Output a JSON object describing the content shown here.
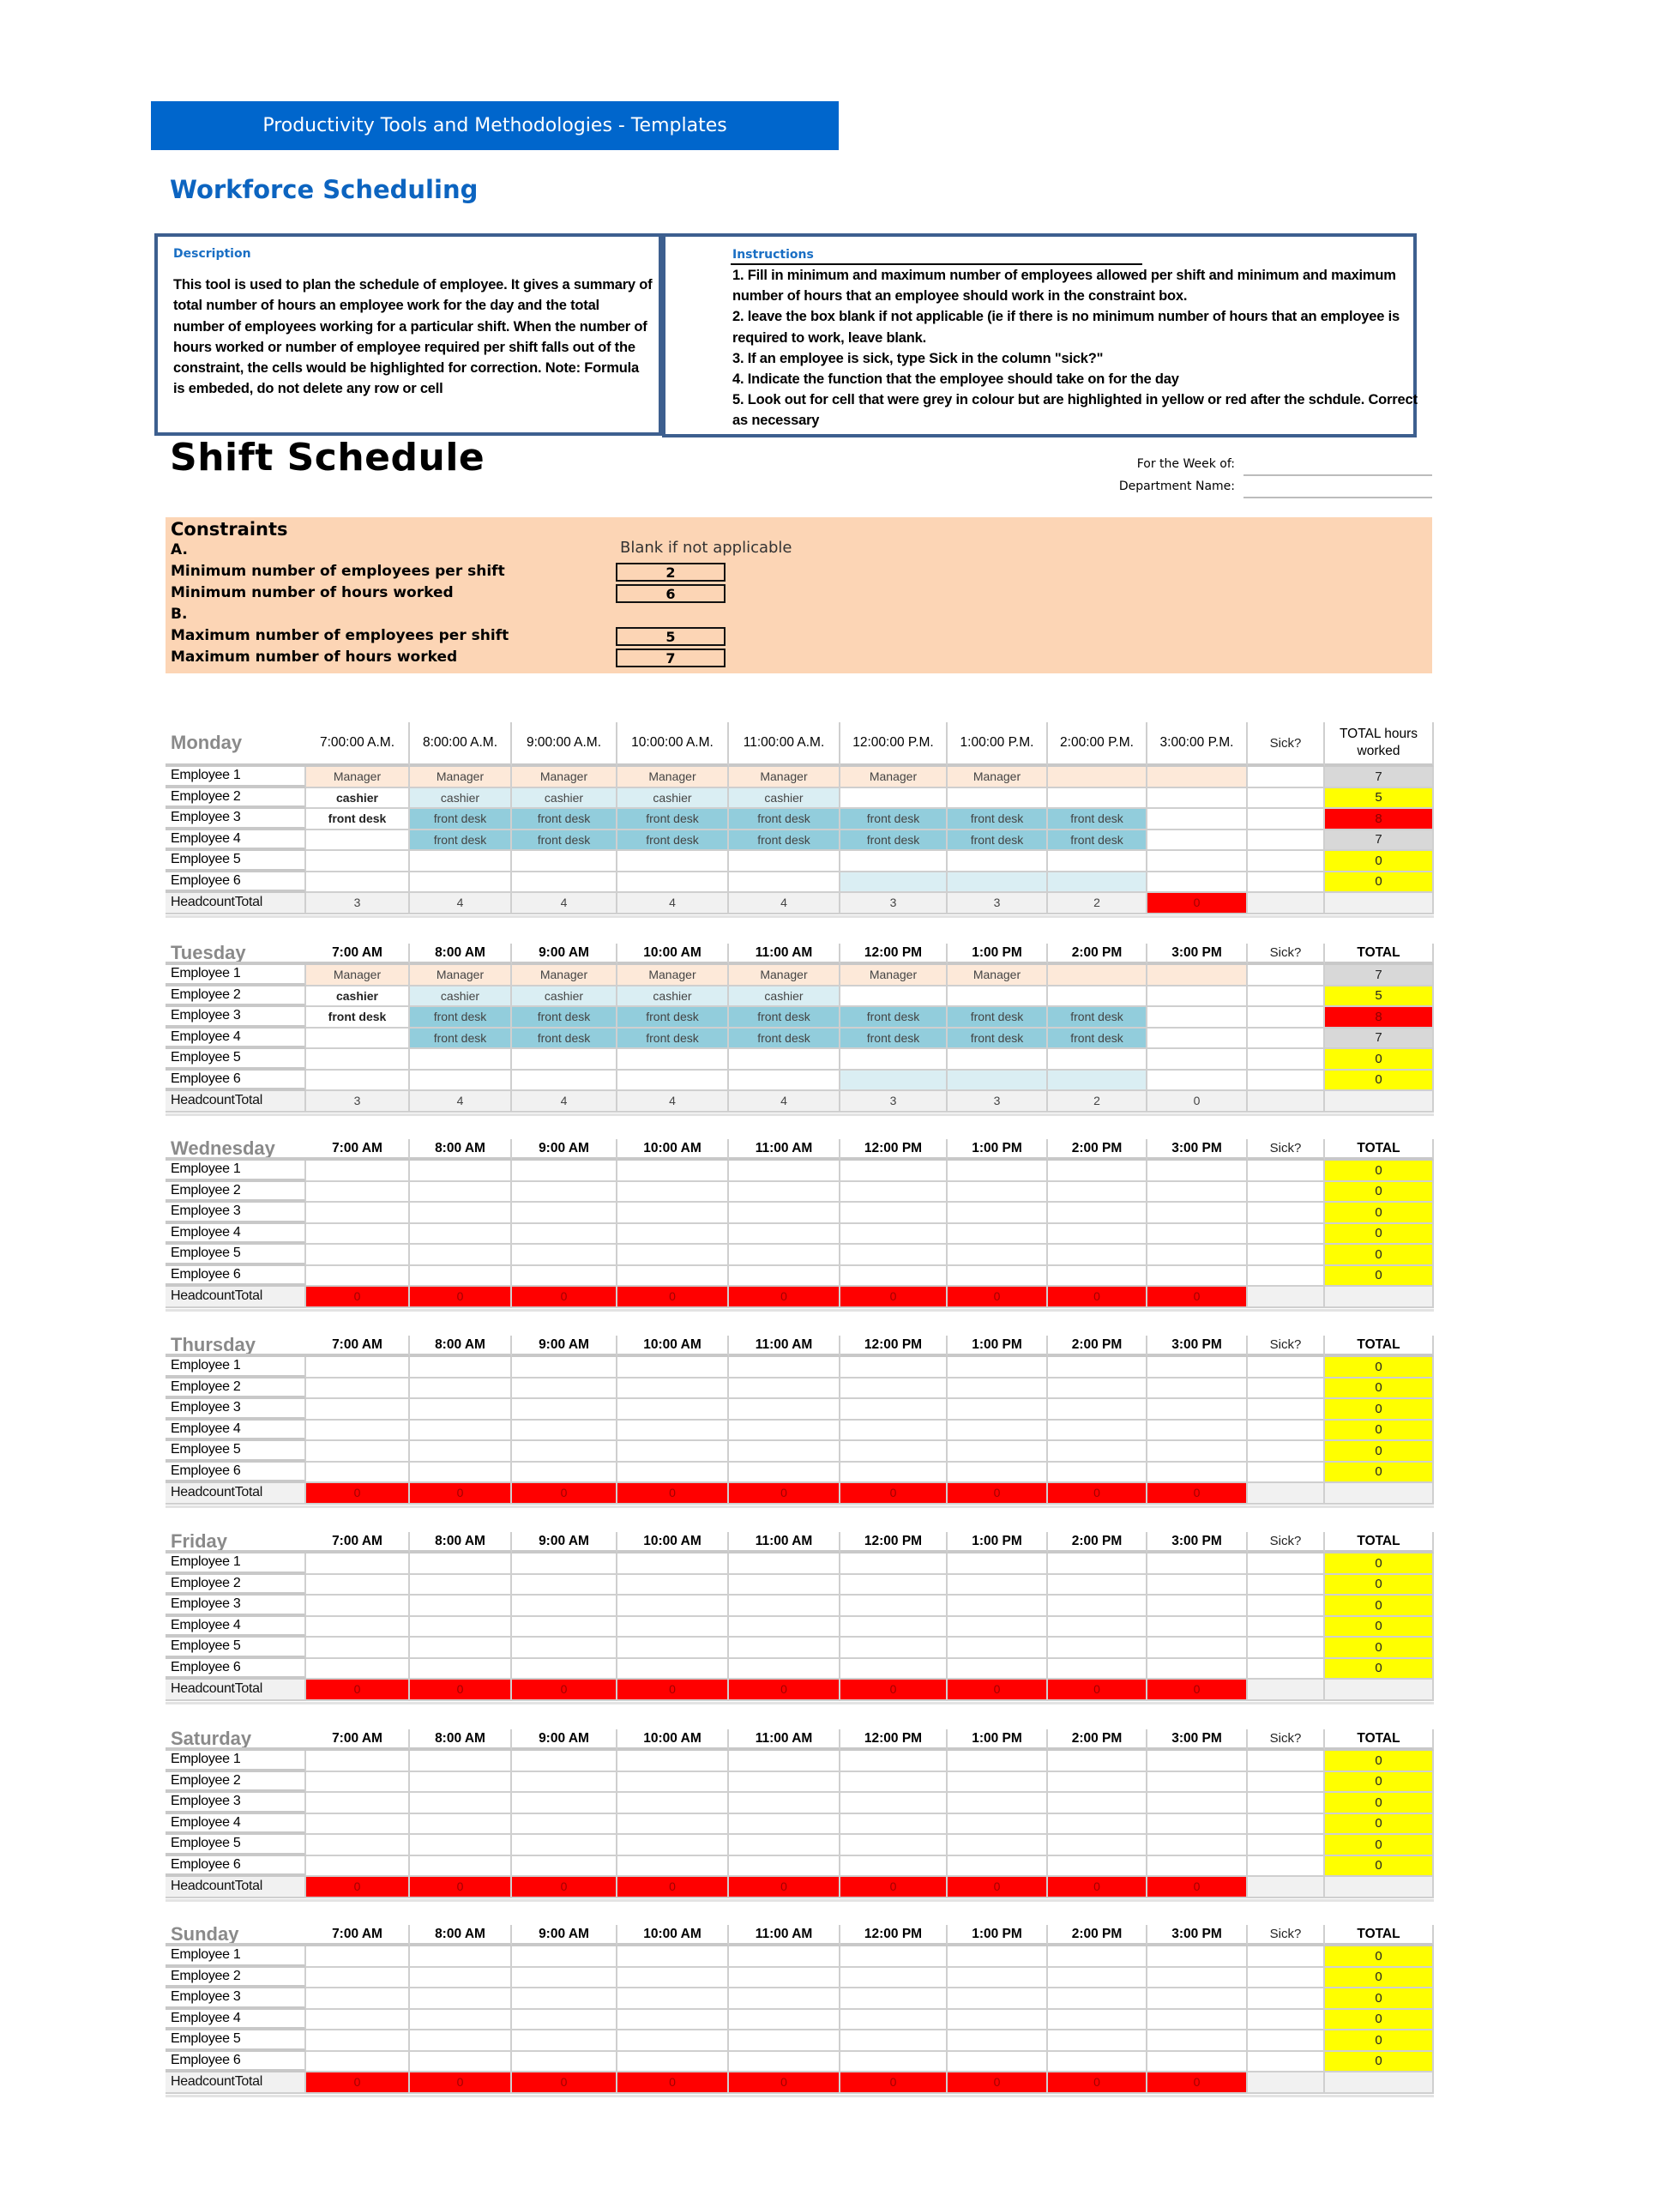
{
  "banner": {
    "title": "Productivity Tools and Methodologies - Templates"
  },
  "page_title": "Workforce Scheduling",
  "description": {
    "heading": "Description",
    "text": "This tool is used to plan the schedule of employee. It gives a summary of total number of hours an employee work for the day and the total number of employees working for a particular shift. When the number of hours worked or number of employee required per shift falls out of the constraint, the cells would be highlighted for correction. Note: Formula is embeded, do not delete any row or cell"
  },
  "instructions": {
    "heading": "Instructions",
    "items": [
      "1. Fill in minimum and maximum number of employees allowed per shift and minimum  and maximum number of hours that an employee should work in the constraint box.",
      "2. leave the box blank if not applicable (ie if there is no minimum number of hours that an employee is required to work, leave blank.",
      "3. If an employee is sick, type Sick in the column \"sick?\"",
      "4. Indicate the function that the employee should take on for the day",
      "5. Look out for cell that were grey in colour but are highlighted in yellow or red after the schdule. Correct as necessary"
    ]
  },
  "schedule": {
    "title": "Shift Schedule",
    "week_label": "For the Week of:",
    "week_value": "",
    "department_label": "Department Name:",
    "department_value": ""
  },
  "constraints": {
    "title": "Constraints",
    "section_a": "A.",
    "section_b": "B.",
    "note": "Blank if not applicable",
    "min_employees_label": "Minimum number of employees per shift",
    "min_employees": "2",
    "min_hours_label": "Minimum number of hours worked",
    "min_hours": "6",
    "max_employees_label": "Maximum number of employees per shift",
    "max_employees": "5",
    "max_hours_label": "Maximum number of hours worked",
    "max_hours": "7"
  },
  "colors": {
    "banner": "#0066cc",
    "manager": "#fde9d9",
    "cashier": "#daeef3",
    "front_desk": "#92cddc",
    "warning_yellow": "#ffff00",
    "error_red": "#ff0000",
    "ok_grey": "#d8d8d8",
    "constraints_bg": "#fcd5b5"
  },
  "row_labels": [
    "Employee 1",
    "Employee 2",
    "Employee 3",
    "Employee 4",
    "Employee 5",
    "Employee 6"
  ],
  "headcount_label": "HeadcountTotal",
  "sick_label": "Sick?",
  "days": [
    {
      "name": "Monday",
      "times": [
        "7:00:00 A.M.",
        "8:00:00 A.M.",
        "9:00:00 A.M.",
        "10:00:00 A.M.",
        "11:00:00 A.M.",
        "12:00:00 P.M.",
        "1:00:00 P.M.",
        "2:00:00 P.M.",
        "3:00:00 P.M."
      ],
      "total_label": "TOTAL hours worked",
      "employees": [
        {
          "cells": [
            "Manager",
            "Manager",
            "Manager",
            "Manager",
            "Manager",
            "Manager",
            "Manager",
            "",
            ""
          ],
          "sick": "",
          "total": "7",
          "status": "ok"
        },
        {
          "cells": [
            "cashier",
            "cashier",
            "cashier",
            "cashier",
            "cashier",
            "",
            "",
            "",
            ""
          ],
          "sick": "",
          "total": "5",
          "status": "warn"
        },
        {
          "cells": [
            "front desk",
            "front desk",
            "front desk",
            "front desk",
            "front desk",
            "front desk",
            "front desk",
            "front desk",
            ""
          ],
          "sick": "",
          "total": "8",
          "status": "error"
        },
        {
          "cells": [
            "",
            "front desk",
            "front desk",
            "front desk",
            "front desk",
            "front desk",
            "front desk",
            "front desk",
            ""
          ],
          "sick": "",
          "total": "7",
          "status": "ok"
        },
        {
          "cells": [
            "",
            "",
            "",
            "",
            "",
            "",
            "",
            "",
            ""
          ],
          "sick": "",
          "total": "0",
          "status": "warn"
        },
        {
          "cells": [
            "",
            "",
            "",
            "",
            "",
            "",
            "",
            "",
            ""
          ],
          "sick": "",
          "total": "0",
          "status": "warn"
        }
      ],
      "headcount": [
        "3",
        "4",
        "4",
        "4",
        "4",
        "3",
        "3",
        "2",
        "0"
      ],
      "headcount_flags": [
        false,
        false,
        false,
        false,
        false,
        false,
        false,
        false,
        true
      ]
    },
    {
      "name": "Tuesday",
      "times": [
        "7:00 AM",
        "8:00 AM",
        "9:00 AM",
        "10:00 AM",
        "11:00 AM",
        "12:00 PM",
        "1:00 PM",
        "2:00 PM",
        "3:00 PM"
      ],
      "total_label": "TOTAL",
      "employees": [
        {
          "cells": [
            "Manager",
            "Manager",
            "Manager",
            "Manager",
            "Manager",
            "Manager",
            "Manager",
            "",
            ""
          ],
          "sick": "",
          "total": "7",
          "status": "ok"
        },
        {
          "cells": [
            "cashier",
            "cashier",
            "cashier",
            "cashier",
            "cashier",
            "",
            "",
            "",
            ""
          ],
          "sick": "",
          "total": "5",
          "status": "warn"
        },
        {
          "cells": [
            "front desk",
            "front desk",
            "front desk",
            "front desk",
            "front desk",
            "front desk",
            "front desk",
            "front desk",
            ""
          ],
          "sick": "",
          "total": "8",
          "status": "error"
        },
        {
          "cells": [
            "",
            "front desk",
            "front desk",
            "front desk",
            "front desk",
            "front desk",
            "front desk",
            "front desk",
            ""
          ],
          "sick": "",
          "total": "7",
          "status": "ok"
        },
        {
          "cells": [
            "",
            "",
            "",
            "",
            "",
            "",
            "",
            "",
            ""
          ],
          "sick": "",
          "total": "0",
          "status": "warn"
        },
        {
          "cells": [
            "",
            "",
            "",
            "",
            "",
            "",
            "",
            "",
            ""
          ],
          "sick": "",
          "total": "0",
          "status": "warn"
        }
      ],
      "headcount": [
        "3",
        "4",
        "4",
        "4",
        "4",
        "3",
        "3",
        "2",
        "0"
      ],
      "headcount_flags": [
        false,
        false,
        false,
        false,
        false,
        false,
        false,
        false,
        false
      ]
    },
    {
      "name": "Wednesday",
      "times": [
        "7:00 AM",
        "8:00 AM",
        "9:00 AM",
        "10:00 AM",
        "11:00 AM",
        "12:00 PM",
        "1:00 PM",
        "2:00 PM",
        "3:00 PM"
      ],
      "total_label": "TOTAL",
      "employees": [
        {
          "cells": [
            "",
            "",
            "",
            "",
            "",
            "",
            "",
            "",
            ""
          ],
          "sick": "",
          "total": "0",
          "status": "warn"
        },
        {
          "cells": [
            "",
            "",
            "",
            "",
            "",
            "",
            "",
            "",
            ""
          ],
          "sick": "",
          "total": "0",
          "status": "warn"
        },
        {
          "cells": [
            "",
            "",
            "",
            "",
            "",
            "",
            "",
            "",
            ""
          ],
          "sick": "",
          "total": "0",
          "status": "warn"
        },
        {
          "cells": [
            "",
            "",
            "",
            "",
            "",
            "",
            "",
            "",
            ""
          ],
          "sick": "",
          "total": "0",
          "status": "warn"
        },
        {
          "cells": [
            "",
            "",
            "",
            "",
            "",
            "",
            "",
            "",
            ""
          ],
          "sick": "",
          "total": "0",
          "status": "warn"
        },
        {
          "cells": [
            "",
            "",
            "",
            "",
            "",
            "",
            "",
            "",
            ""
          ],
          "sick": "",
          "total": "0",
          "status": "warn"
        }
      ],
      "headcount": [
        "0",
        "0",
        "0",
        "0",
        "0",
        "0",
        "0",
        "0",
        "0"
      ],
      "headcount_flags": [
        true,
        true,
        true,
        true,
        true,
        true,
        true,
        true,
        true
      ]
    },
    {
      "name": "Thursday",
      "times": [
        "7:00 AM",
        "8:00 AM",
        "9:00 AM",
        "10:00 AM",
        "11:00 AM",
        "12:00 PM",
        "1:00 PM",
        "2:00 PM",
        "3:00 PM"
      ],
      "total_label": "TOTAL",
      "employees": [
        {
          "cells": [
            "",
            "",
            "",
            "",
            "",
            "",
            "",
            "",
            ""
          ],
          "sick": "",
          "total": "0",
          "status": "warn"
        },
        {
          "cells": [
            "",
            "",
            "",
            "",
            "",
            "",
            "",
            "",
            ""
          ],
          "sick": "",
          "total": "0",
          "status": "warn"
        },
        {
          "cells": [
            "",
            "",
            "",
            "",
            "",
            "",
            "",
            "",
            ""
          ],
          "sick": "",
          "total": "0",
          "status": "warn"
        },
        {
          "cells": [
            "",
            "",
            "",
            "",
            "",
            "",
            "",
            "",
            ""
          ],
          "sick": "",
          "total": "0",
          "status": "warn"
        },
        {
          "cells": [
            "",
            "",
            "",
            "",
            "",
            "",
            "",
            "",
            ""
          ],
          "sick": "",
          "total": "0",
          "status": "warn"
        },
        {
          "cells": [
            "",
            "",
            "",
            "",
            "",
            "",
            "",
            "",
            ""
          ],
          "sick": "",
          "total": "0",
          "status": "warn"
        }
      ],
      "headcount": [
        "0",
        "0",
        "0",
        "0",
        "0",
        "0",
        "0",
        "0",
        "0"
      ],
      "headcount_flags": [
        true,
        true,
        true,
        true,
        true,
        true,
        true,
        true,
        true
      ]
    },
    {
      "name": "Friday",
      "times": [
        "7:00 AM",
        "8:00 AM",
        "9:00 AM",
        "10:00 AM",
        "11:00 AM",
        "12:00 PM",
        "1:00 PM",
        "2:00 PM",
        "3:00 PM"
      ],
      "total_label": "TOTAL",
      "employees": [
        {
          "cells": [
            "",
            "",
            "",
            "",
            "",
            "",
            "",
            "",
            ""
          ],
          "sick": "",
          "total": "0",
          "status": "warn"
        },
        {
          "cells": [
            "",
            "",
            "",
            "",
            "",
            "",
            "",
            "",
            ""
          ],
          "sick": "",
          "total": "0",
          "status": "warn"
        },
        {
          "cells": [
            "",
            "",
            "",
            "",
            "",
            "",
            "",
            "",
            ""
          ],
          "sick": "",
          "total": "0",
          "status": "warn"
        },
        {
          "cells": [
            "",
            "",
            "",
            "",
            "",
            "",
            "",
            "",
            ""
          ],
          "sick": "",
          "total": "0",
          "status": "warn"
        },
        {
          "cells": [
            "",
            "",
            "",
            "",
            "",
            "",
            "",
            "",
            ""
          ],
          "sick": "",
          "total": "0",
          "status": "warn"
        },
        {
          "cells": [
            "",
            "",
            "",
            "",
            "",
            "",
            "",
            "",
            ""
          ],
          "sick": "",
          "total": "0",
          "status": "warn"
        }
      ],
      "headcount": [
        "0",
        "0",
        "0",
        "0",
        "0",
        "0",
        "0",
        "0",
        "0"
      ],
      "headcount_flags": [
        true,
        true,
        true,
        true,
        true,
        true,
        true,
        true,
        true
      ]
    },
    {
      "name": "Saturday",
      "times": [
        "7:00 AM",
        "8:00 AM",
        "9:00 AM",
        "10:00 AM",
        "11:00 AM",
        "12:00 PM",
        "1:00 PM",
        "2:00 PM",
        "3:00 PM"
      ],
      "total_label": "TOTAL",
      "employees": [
        {
          "cells": [
            "",
            "",
            "",
            "",
            "",
            "",
            "",
            "",
            ""
          ],
          "sick": "",
          "total": "0",
          "status": "warn"
        },
        {
          "cells": [
            "",
            "",
            "",
            "",
            "",
            "",
            "",
            "",
            ""
          ],
          "sick": "",
          "total": "0",
          "status": "warn"
        },
        {
          "cells": [
            "",
            "",
            "",
            "",
            "",
            "",
            "",
            "",
            ""
          ],
          "sick": "",
          "total": "0",
          "status": "warn"
        },
        {
          "cells": [
            "",
            "",
            "",
            "",
            "",
            "",
            "",
            "",
            ""
          ],
          "sick": "",
          "total": "0",
          "status": "warn"
        },
        {
          "cells": [
            "",
            "",
            "",
            "",
            "",
            "",
            "",
            "",
            ""
          ],
          "sick": "",
          "total": "0",
          "status": "warn"
        },
        {
          "cells": [
            "",
            "",
            "",
            "",
            "",
            "",
            "",
            "",
            ""
          ],
          "sick": "",
          "total": "0",
          "status": "warn"
        }
      ],
      "headcount": [
        "0",
        "0",
        "0",
        "0",
        "0",
        "0",
        "0",
        "0",
        "0"
      ],
      "headcount_flags": [
        true,
        true,
        true,
        true,
        true,
        true,
        true,
        true,
        true
      ]
    },
    {
      "name": "Sunday",
      "times": [
        "7:00 AM",
        "8:00 AM",
        "9:00 AM",
        "10:00 AM",
        "11:00 AM",
        "12:00 PM",
        "1:00 PM",
        "2:00 PM",
        "3:00 PM"
      ],
      "total_label": "TOTAL",
      "employees": [
        {
          "cells": [
            "",
            "",
            "",
            "",
            "",
            "",
            "",
            "",
            ""
          ],
          "sick": "",
          "total": "0",
          "status": "warn"
        },
        {
          "cells": [
            "",
            "",
            "",
            "",
            "",
            "",
            "",
            "",
            ""
          ],
          "sick": "",
          "total": "0",
          "status": "warn"
        },
        {
          "cells": [
            "",
            "",
            "",
            "",
            "",
            "",
            "",
            "",
            ""
          ],
          "sick": "",
          "total": "0",
          "status": "warn"
        },
        {
          "cells": [
            "",
            "",
            "",
            "",
            "",
            "",
            "",
            "",
            ""
          ],
          "sick": "",
          "total": "0",
          "status": "warn"
        },
        {
          "cells": [
            "",
            "",
            "",
            "",
            "",
            "",
            "",
            "",
            ""
          ],
          "sick": "",
          "total": "0",
          "status": "warn"
        },
        {
          "cells": [
            "",
            "",
            "",
            "",
            "",
            "",
            "",
            "",
            ""
          ],
          "sick": "",
          "total": "0",
          "status": "warn"
        }
      ],
      "headcount": [
        "0",
        "0",
        "0",
        "0",
        "0",
        "0",
        "0",
        "0",
        "0"
      ],
      "headcount_flags": [
        true,
        true,
        true,
        true,
        true,
        true,
        true,
        true,
        true
      ]
    }
  ]
}
